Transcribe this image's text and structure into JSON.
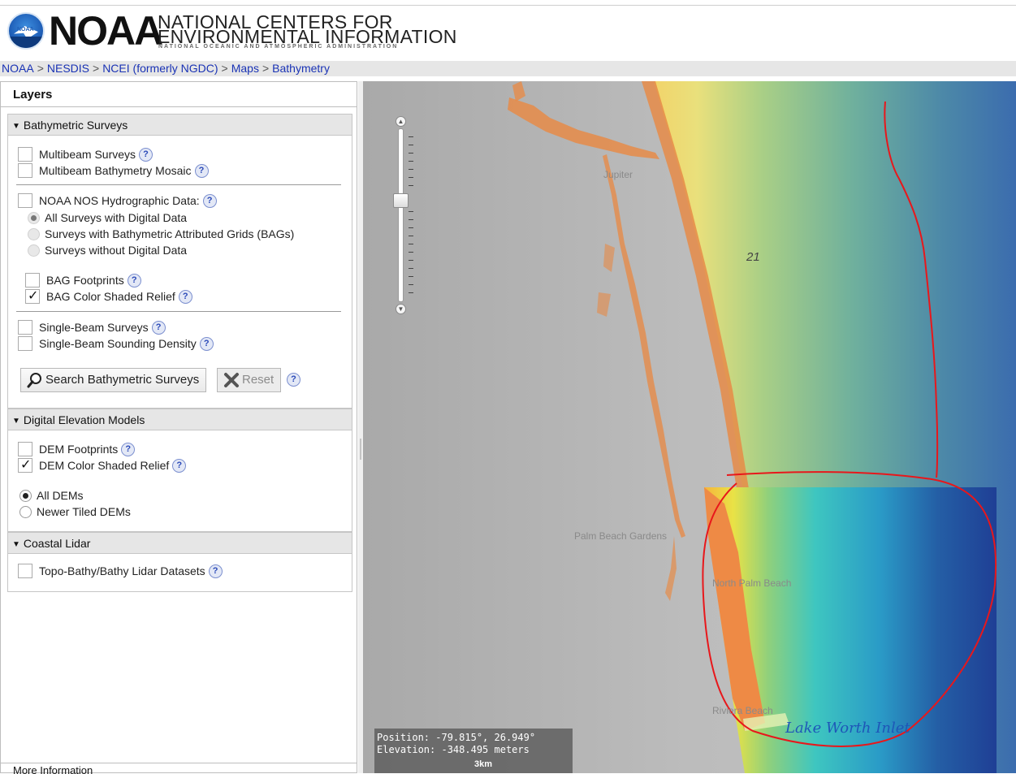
{
  "header": {
    "logo_circle_text": "NOAA",
    "logo_word": "NOAA",
    "ncei_line1": "NATIONAL CENTERS FOR",
    "ncei_line2": "ENVIRONMENTAL INFORMATION",
    "ncei_line3": "NATIONAL OCEANIC AND ATMOSPHERIC ADMINISTRATION"
  },
  "breadcrumb": {
    "items": [
      "NOAA",
      "NESDIS",
      "NCEI (formerly NGDC)",
      "Maps",
      "Bathymetry"
    ],
    "separator": ">"
  },
  "layers_panel": {
    "title": "Layers",
    "sections": {
      "bathymetric": {
        "title": "Bathymetric Surveys",
        "multibeam_surveys": "Multibeam Surveys",
        "multibeam_mosaic": "Multibeam Bathymetry Mosaic",
        "nos_hydro": "NOAA NOS Hydrographic Data:",
        "radio_all_digital": "All Surveys with Digital Data",
        "radio_bags": "Surveys with Bathymetric Attributed Grids (BAGs)",
        "radio_no_digital": "Surveys without Digital Data",
        "bag_footprints": "BAG Footprints",
        "bag_relief": "BAG Color Shaded Relief",
        "single_beam": "Single-Beam Surveys",
        "single_beam_density": "Single-Beam Sounding Density",
        "search_button": "Search Bathymetric Surveys",
        "reset_button": "Reset"
      },
      "dem": {
        "title": "Digital Elevation Models",
        "dem_footprints": "DEM Footprints",
        "dem_relief": "DEM Color Shaded Relief",
        "radio_all_dems": "All DEMs",
        "radio_newer_dems": "Newer Tiled DEMs"
      },
      "lidar": {
        "title": "Coastal Lidar",
        "topo_bathy": "Topo-Bathy/Bathy Lidar Datasets"
      }
    },
    "help_glyph": "?",
    "more_information": "More Information"
  },
  "map": {
    "labels": {
      "jupiter": "Jupiter",
      "palm_beach_gardens": "Palm Beach Gardens",
      "north_palm_beach": "North Palm Beach",
      "riviera_beach": "Riviera Beach",
      "lake_worth_inlet": "Lake Worth Inlet",
      "depth": "21"
    },
    "position_text": "Position: -79.815°, 26.949°",
    "elevation_text": "Elevation: -348.495 meters",
    "scale_text": "3km",
    "annotation_color": "#e8171b"
  }
}
